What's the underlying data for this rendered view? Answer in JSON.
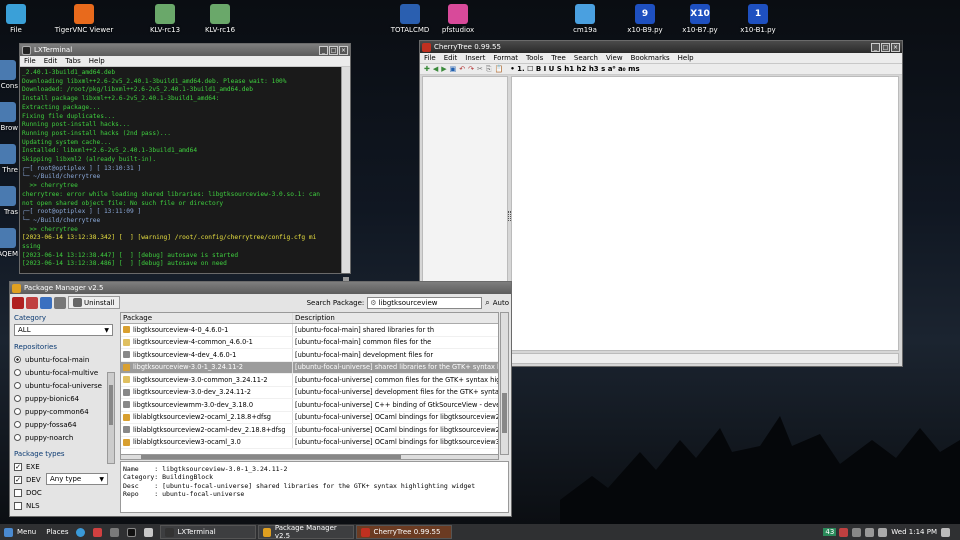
{
  "desktop": {
    "top_icons": [
      {
        "label": "File",
        "icon": "home-folder-icon",
        "color": "#3aa0d8"
      },
      {
        "label": "TigerVNC Viewer",
        "icon": "tiger-icon",
        "color": "#e86a1c"
      },
      {
        "label": "KLV-rc13",
        "icon": "klv-icon",
        "color": "#6aa86a"
      },
      {
        "label": "KLV-rc16",
        "icon": "klv-icon",
        "color": "#6aa86a"
      },
      {
        "label": "TOTALCMD",
        "icon": "floppy-icon",
        "color": "#2a5fb0"
      },
      {
        "label": "pfstudiox",
        "icon": "film-icon",
        "color": "#d84a9a"
      },
      {
        "label": "cm19a",
        "icon": "wireless-icon",
        "color": "#4aa0e0"
      },
      {
        "label": "x10-B9.py",
        "icon": "x10-icon",
        "color": "#1e50c0",
        "badge": "9"
      },
      {
        "label": "x10-B7.py",
        "icon": "x10-icon",
        "color": "#1e50c0",
        "badge": "X10"
      },
      {
        "label": "x10-B1.py",
        "icon": "x10-icon",
        "color": "#1e50c0",
        "badge": "1"
      }
    ],
    "left_icons": [
      "Cons",
      "Brow",
      "Thre",
      "Tras",
      "AQEM"
    ]
  },
  "terminal": {
    "title": "LXTerminal",
    "menu": [
      "File",
      "Edit",
      "Tabs",
      "Help"
    ],
    "lines": [
      "_2.40.1-3build1_amd64.deb",
      "Downloading libxml++2.6-2v5_2.40.1-3build1_amd64.deb. Please wait: 100%",
      "Downloaded: /root/pkg/libxml++2.6-2v5_2.40.1-3build1_amd64.deb",
      "Install package libxml++2.6-2v5_2.40.1-3build1_amd64:",
      "Extracting package...",
      "Fixing file duplicates...",
      "Running post-install hacks...",
      "Running post-install hacks (2nd pass)...",
      "Updating system cache...",
      "Installed: libxml++2.6-2v5_2.40.1-3build1_amd64",
      "Skipping libxml2 (already built-in).",
      "┌─[ root@optiplex ] [ 13:10:31 ]",
      "└─ ~/Build/cherrytree",
      "  >> cherrytree",
      "cherrytree: error while loading shared libraries: libgtksourceview-3.0.so.1: can",
      "not open shared object file: No such file or directory",
      "┌─[ root@optiplex ] [ 13:11:09 ]",
      "└─ ~/Build/cherrytree",
      "  >> cherrytree",
      "[2023-06-14 13:12:38.342] [  ] [warning] /root/.config/cherrytree/config.cfg mi",
      "ssing",
      "[2023-06-14 13:12:38.447] [  ] [debug] autosave is started",
      "[2023-06-14 13:12:38.486] [  ] [debug] autosave on need"
    ]
  },
  "cherrytree": {
    "title": "CherryTree 0.99.55",
    "menu": [
      "File",
      "Edit",
      "Insert",
      "Format",
      "Tools",
      "Tree",
      "Search",
      "View",
      "Bookmarks",
      "Help"
    ],
    "toolbar_text": "• 1. ☐ B I U S h1 h2 h3 s a⁰ a₀ ms"
  },
  "package_manager": {
    "title": "Package Manager v2.5",
    "uninstall": "Uninstall",
    "search_label": "Search Package:",
    "search_value": "libgtksourceview",
    "auto_label": "Auto",
    "category_label": "Category",
    "category_value": "ALL",
    "repos_label": "Repositories",
    "repos": [
      {
        "name": "ubuntu-focal-main",
        "selected": true
      },
      {
        "name": "ubuntu-focal-multive",
        "selected": false
      },
      {
        "name": "ubuntu-focal-universe",
        "selected": false
      },
      {
        "name": "puppy-bionic64",
        "selected": false
      },
      {
        "name": "puppy-common64",
        "selected": false
      },
      {
        "name": "puppy-fossa64",
        "selected": false
      },
      {
        "name": "puppy-noarch",
        "selected": false
      }
    ],
    "types_label": "Package types",
    "types": [
      {
        "name": "EXE",
        "checked": true
      },
      {
        "name": "DEV",
        "checked": true
      },
      {
        "name": "DOC",
        "checked": false
      },
      {
        "name": "NLS",
        "checked": false
      }
    ],
    "type_select": "Any type",
    "columns": [
      "Package",
      "Description"
    ],
    "rows": [
      {
        "pkg": "libgtksourceview-4-0_4.6.0-1",
        "desc": "[ubuntu-focal-main] shared libraries for th",
        "icon": "#d9a030",
        "sel": false
      },
      {
        "pkg": "libgtksourceview-4-common_4.6.0-1",
        "desc": "[ubuntu-focal-main] common files for the",
        "icon": "#e0c060",
        "sel": false
      },
      {
        "pkg": "libgtksourceview-4-dev_4.6.0-1",
        "desc": "[ubuntu-focal-main] development files for",
        "icon": "#888888",
        "sel": false
      },
      {
        "pkg": "libgtksourceview-3.0-1_3.24.11-2",
        "desc": "[ubuntu-focal-universe] shared libraries for the GTK+ syntax h",
        "icon": "#d9a030",
        "sel": true
      },
      {
        "pkg": "libgtksourceview-3.0-common_3.24.11-2",
        "desc": "[ubuntu-focal-universe] common files for the GTK+ syntax highlig",
        "icon": "#e0c060",
        "sel": false
      },
      {
        "pkg": "libgtksourceview-3.0-dev_3.24.11-2",
        "desc": "[ubuntu-focal-universe] development files for the GTK+ syntax hig",
        "icon": "#888888",
        "sel": false
      },
      {
        "pkg": "libgtksourceviewmm-3.0-dev_3.18.0",
        "desc": "[ubuntu-focal-universe] C++ binding of GtkSourceView - developm",
        "icon": "#888888",
        "sel": false
      },
      {
        "pkg": "liblablgtksourceview2-ocaml_2.18.8+dfsg",
        "desc": "[ubuntu-focal-universe] OCaml bindings for libgtksourceview2 run",
        "icon": "#d9a030",
        "sel": false
      },
      {
        "pkg": "liblablgtksourceview2-ocaml-dev_2.18.8+dfsg",
        "desc": "[ubuntu-focal-universe] OCaml bindings for libgtksourceview2 a so",
        "icon": "#888888",
        "sel": false
      },
      {
        "pkg": "liblablgtksourceview3-ocaml_3.0",
        "desc": "[ubuntu-focal-universe] OCaml bindings for libgtksourceview3 run",
        "icon": "#d9a030",
        "sel": false
      }
    ],
    "details": [
      "Name    : libgtksourceview-3.0-1_3.24.11-2",
      "Category: BuildingBlock",
      "Desc    : [ubuntu-focal-universe] shared libraries for the GTK+ syntax highlighting widget",
      "Repo    : ubuntu-focal-universe"
    ]
  },
  "taskbar": {
    "menu": "Menu",
    "places": "Places",
    "tasks": [
      {
        "label": "LXTerminal",
        "active": false,
        "color": "#333"
      },
      {
        "label": "Package Manager v2.5",
        "active": false,
        "color": "#e0a020"
      },
      {
        "label": "CherryTree 0.99.55",
        "active": true,
        "color": "#c03020"
      }
    ],
    "workspace": "43",
    "clock": "Wed  1:14 PM"
  }
}
